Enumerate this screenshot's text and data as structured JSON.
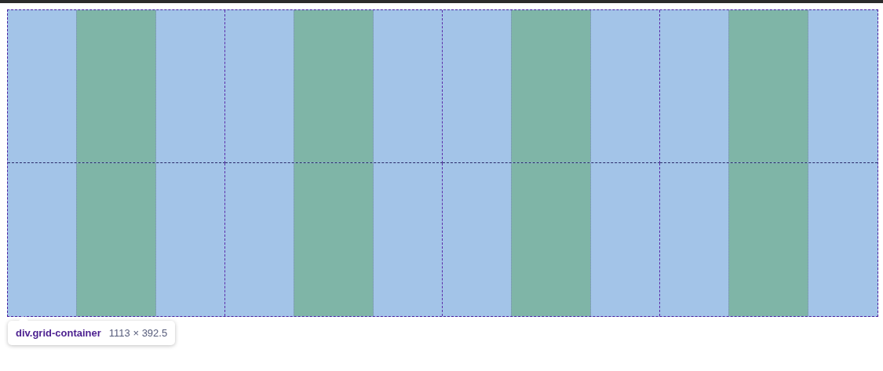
{
  "grid_tooltip": {
    "selector": "div.grid-container",
    "size": "1113 × 392.5"
  }
}
